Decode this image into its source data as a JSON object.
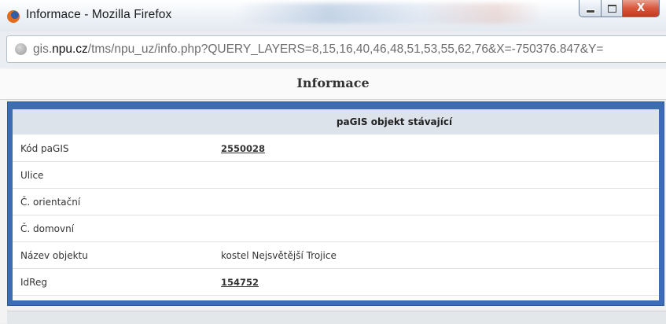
{
  "window": {
    "title": "Informace - Mozilla Firefox",
    "close_glyph": "X"
  },
  "address_bar": {
    "url_prefix": "gis.",
    "url_domain": "npu.cz",
    "url_rest": "/tms/npu_uz/info.php?QUERY_LAYERS=8,15,16,40,46,48,51,53,55,62,76&X=-750376.847&Y="
  },
  "page": {
    "heading": "Informace"
  },
  "table": {
    "header": "paGIS objekt stávající",
    "rows": [
      {
        "label": "Kód paGIS",
        "value": "2550028",
        "is_link": true
      },
      {
        "label": "Ulice",
        "value": "",
        "is_link": false
      },
      {
        "label": "Č. orientační",
        "value": "",
        "is_link": false
      },
      {
        "label": "Č. domovní",
        "value": "",
        "is_link": false
      },
      {
        "label": "Název objektu",
        "value": "kostel Nejsvětější Trojice",
        "is_link": false
      },
      {
        "label": "IdReg",
        "value": "154752",
        "is_link": true
      }
    ]
  },
  "colors": {
    "frame_blue": "#3d6db0",
    "header_bg": "#dde3ea",
    "close_red": "#c23b1e"
  },
  "icons": {
    "browser": "firefox-icon",
    "site": "globe-icon"
  }
}
